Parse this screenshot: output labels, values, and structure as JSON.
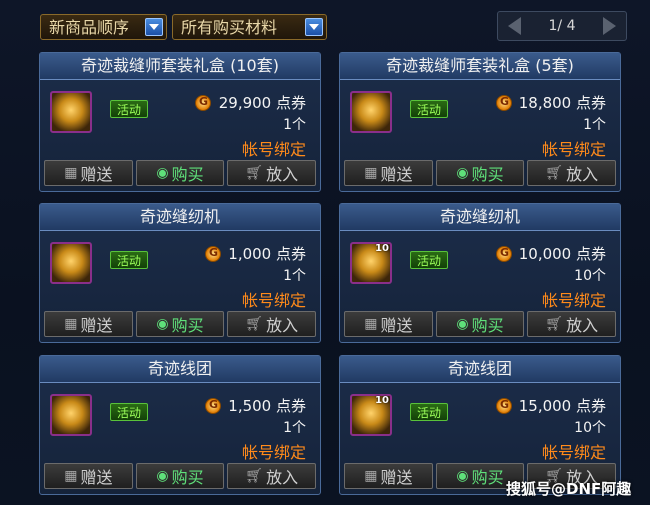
{
  "filters": {
    "sort": "新商品顺序",
    "category": "所有购买材料"
  },
  "pager": {
    "text": "1/ 4"
  },
  "items": [
    {
      "title": "奇迹裁缝师套装礼盒 (10套)",
      "event": "活动",
      "price": "29,900 点券",
      "qty": "1个",
      "bind": "帐号绑定",
      "icon_count": ""
    },
    {
      "title": "奇迹裁缝师套装礼盒 (5套)",
      "event": "活动",
      "price": "18,800 点券",
      "qty": "1个",
      "bind": "帐号绑定",
      "icon_count": ""
    },
    {
      "title": "奇迹缝纫机",
      "event": "活动",
      "price": "1,000 点券",
      "qty": "1个",
      "bind": "帐号绑定",
      "icon_count": ""
    },
    {
      "title": "奇迹缝纫机",
      "event": "活动",
      "price": "10,000 点券",
      "qty": "10个",
      "bind": "帐号绑定",
      "icon_count": "10"
    },
    {
      "title": "奇迹线团",
      "event": "活动",
      "price": "1,500 点券",
      "qty": "1个",
      "bind": "帐号绑定",
      "icon_count": ""
    },
    {
      "title": "奇迹线团",
      "event": "活动",
      "price": "15,000 点券",
      "qty": "10个",
      "bind": "帐号绑定",
      "icon_count": "10"
    }
  ],
  "buttons": {
    "gift": "赠送",
    "buy": "购买",
    "cart": "放入"
  },
  "watermark": "搜狐号@DNF阿趣",
  "icons": {
    "gift": "gift-icon",
    "buy": "coin-bag-icon",
    "cart": "cart-icon",
    "coin": "gold-coin-icon"
  }
}
